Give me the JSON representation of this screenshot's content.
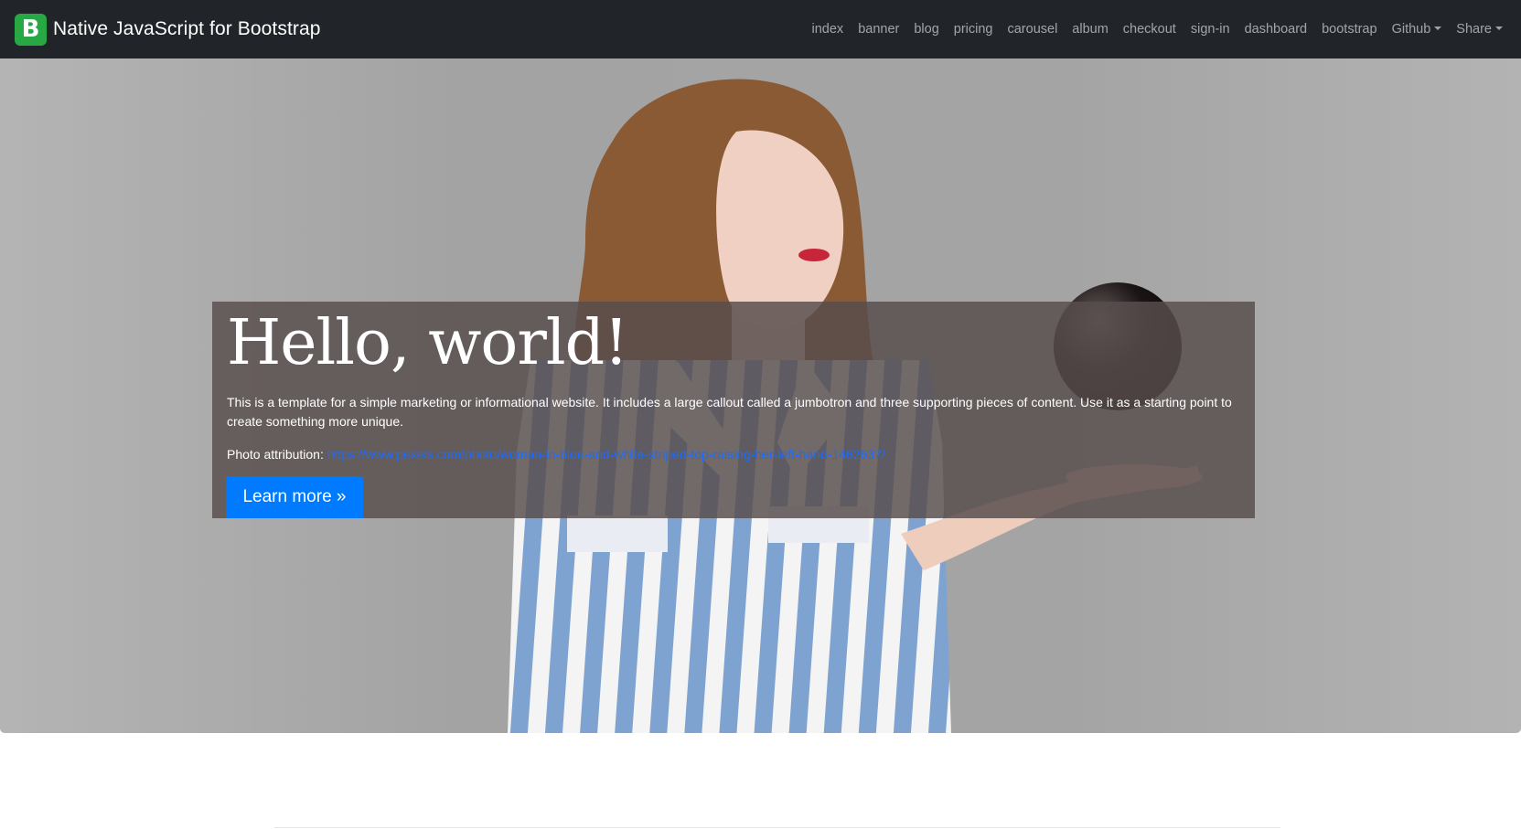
{
  "navbar": {
    "brand_letter": "B",
    "brand_text": "Native JavaScript for Bootstrap",
    "items": [
      {
        "label": "index"
      },
      {
        "label": "banner"
      },
      {
        "label": "blog"
      },
      {
        "label": "pricing"
      },
      {
        "label": "carousel"
      },
      {
        "label": "album"
      },
      {
        "label": "checkout"
      },
      {
        "label": "sign-in"
      },
      {
        "label": "dashboard"
      },
      {
        "label": "bootstrap"
      },
      {
        "label": "Github"
      },
      {
        "label": "Share"
      }
    ],
    "colors": {
      "background": "#212529",
      "brand_logo": "#28a745"
    }
  },
  "hero": {
    "title": "Hello, world!",
    "lead": "This is a template for a simple marketing or informational website. It includes a large callout called a jumbotron and three supporting pieces of content. Use it as a starting point to create something more unique.",
    "attribution_label": "Photo attribution:",
    "attribution_url": "https://www.pexels.com/photo/woman-in-blue-and-white-striped-top-raising-her-left-hand-1462637/",
    "button_label": "Learn more »",
    "colors": {
      "button": "#007bff",
      "link": "#1a6cff",
      "overlay": "#584d4d"
    }
  }
}
